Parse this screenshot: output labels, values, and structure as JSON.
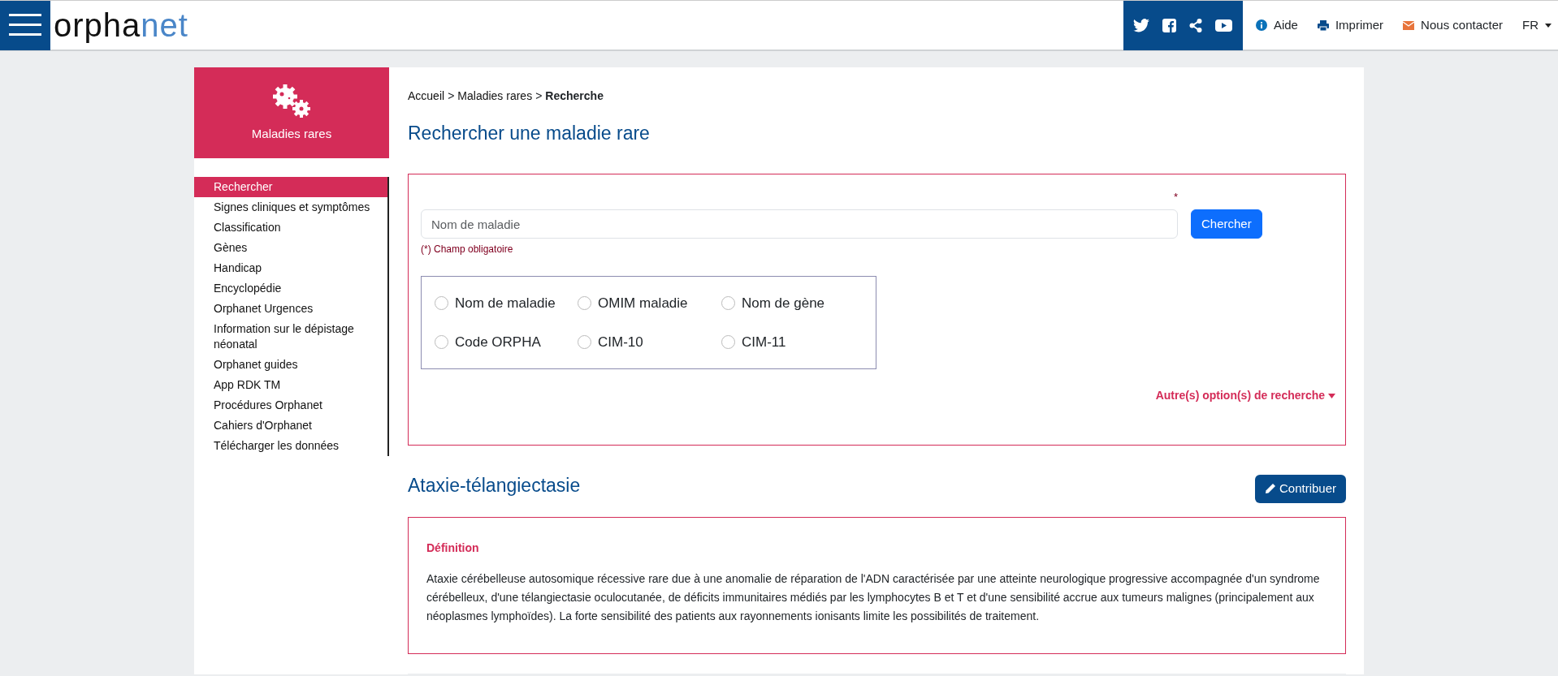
{
  "header": {
    "logo_parts": [
      "orpha",
      "net"
    ],
    "links": [
      {
        "kind": "help",
        "label": "Aide"
      },
      {
        "kind": "print",
        "label": "Imprimer"
      },
      {
        "kind": "contact",
        "label": "Nous contacter"
      }
    ],
    "language": "FR"
  },
  "sidebar": {
    "section_title": "Maladies rares",
    "items": [
      {
        "label": "Rechercher",
        "selected": true
      },
      {
        "label": "Signes cliniques et symptômes",
        "selected": false
      },
      {
        "label": "Classification",
        "selected": false
      },
      {
        "label": "Gènes",
        "selected": false
      },
      {
        "label": "Handicap",
        "selected": false
      },
      {
        "label": "Encyclopédie",
        "selected": false
      },
      {
        "label": "Orphanet Urgences",
        "selected": false
      },
      {
        "label": "Information sur le dépistage néonatal",
        "selected": false
      },
      {
        "label": "Orphanet guides",
        "selected": false
      },
      {
        "label": "App RDK TM",
        "selected": false
      },
      {
        "label": "Procédures Orphanet",
        "selected": false
      },
      {
        "label": "Cahiers d'Orphanet",
        "selected": false
      },
      {
        "label": "Télécharger les données",
        "selected": false
      }
    ]
  },
  "breadcrumb": [
    "Accueil",
    ">",
    "Maladies rares",
    ">",
    "Recherche"
  ],
  "page_title": "Rechercher une maladie rare",
  "search": {
    "required_mark": "*",
    "placeholder": "Nom de maladie",
    "button": "Chercher",
    "required_note": "(*) Champ obligatoire",
    "options": [
      {
        "label": "Nom de maladie",
        "selected": false
      },
      {
        "label": "OMIM maladie",
        "selected": false
      },
      {
        "label": "Nom de gène",
        "selected": false
      },
      {
        "label": "Code ORPHA",
        "selected": false
      },
      {
        "label": "CIM-10",
        "selected": false
      },
      {
        "label": "CIM-11",
        "selected": false
      }
    ],
    "more_options": "Autre(s) option(s) de recherche"
  },
  "disease": {
    "title": "Ataxie-télangiectasie",
    "contribute_button": "Contribuer",
    "definition_heading": "Définition",
    "definition": "Ataxie cérébelleuse autosomique récessive rare due à une anomalie de réparation de l'ADN caractérisée par une atteinte neurologique progressive accompagnée d'un syndrome cérébelleux, d'une télangiectasie oculocutanée, de déficits immunitaires médiés par les lymphocytes B et T et d'une sensibilité accrue aux tumeurs malignes (principalement aux néoplasmes lymphoïdes). La forte sensibilité des patients aux rayonnements ionisants limite les possibilités de traitement."
  }
}
